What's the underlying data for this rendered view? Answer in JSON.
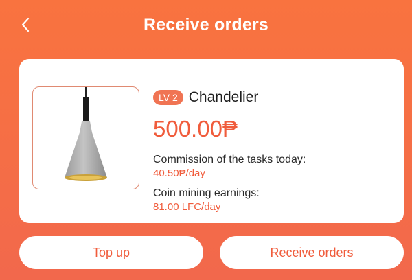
{
  "header": {
    "title": "Receive orders",
    "back_icon": "chevron-left-icon"
  },
  "product": {
    "level_badge": "LV 2",
    "name": "Chandelier",
    "price": "500.00₱",
    "commission_label": "Commission of the tasks today:",
    "commission_value": "40.50₱/day",
    "mining_label": "Coin mining earnings:",
    "mining_value": "81.00 LFC/day"
  },
  "actions": {
    "top_up_label": "Top up",
    "receive_orders_label": "Receive orders"
  },
  "colors": {
    "background": "#f56e46",
    "accent": "#f05c3c",
    "badge": "#f07453"
  }
}
